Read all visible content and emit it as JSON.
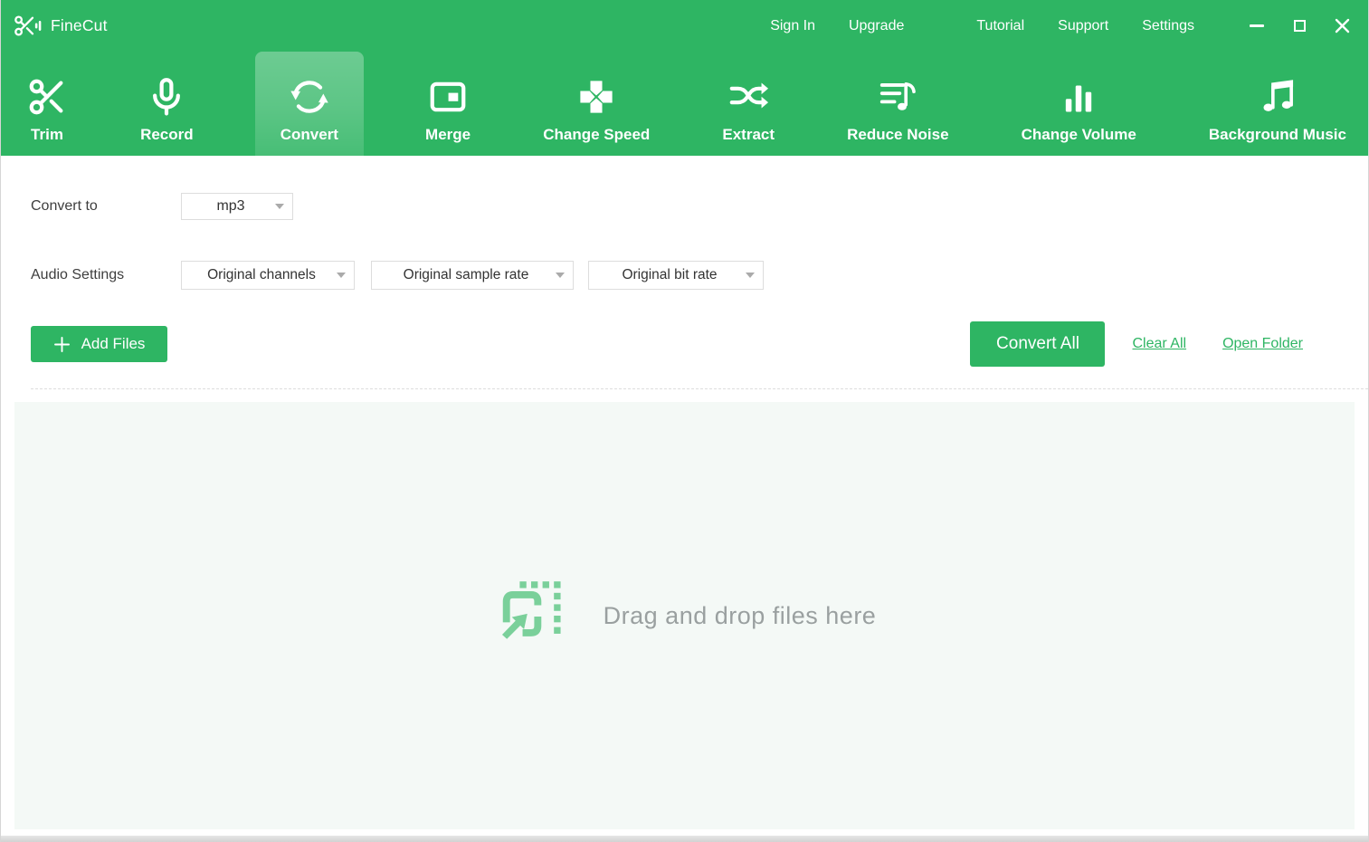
{
  "app": {
    "name": "FineCut"
  },
  "titlebar": {
    "menu": [
      "Sign In",
      "Upgrade",
      "Tutorial",
      "Support",
      "Settings"
    ],
    "controls": {
      "minimize": "minimize",
      "maximize": "maximize",
      "close": "close"
    }
  },
  "tabs": [
    {
      "label": "Trim",
      "active": false
    },
    {
      "label": "Record",
      "active": false
    },
    {
      "label": "Convert",
      "active": true
    },
    {
      "label": "Merge",
      "active": false
    },
    {
      "label": "Change Speed",
      "active": false
    },
    {
      "label": "Extract",
      "active": false
    },
    {
      "label": "Reduce Noise",
      "active": false
    },
    {
      "label": "Change Volume",
      "active": false
    },
    {
      "label": "Background Music",
      "active": false
    }
  ],
  "settings_panel": {
    "convert_to_label": "Convert to",
    "format_value": "mp3",
    "audio_settings_label": "Audio Settings",
    "channels_value": "Original channels",
    "sample_rate_value": "Original sample rate",
    "bit_rate_value": "Original bit rate"
  },
  "actions": {
    "add_files": "Add Files",
    "convert_all": "Convert All",
    "clear_all": "Clear All",
    "open_folder": "Open Folder"
  },
  "dropzone": {
    "message": "Drag and drop files here"
  },
  "colors": {
    "brand_green": "#2eb563",
    "icon_green": "#7ad09a",
    "dropzone_bg": "#f4f9f6",
    "muted_text": "#9aa0a0"
  }
}
